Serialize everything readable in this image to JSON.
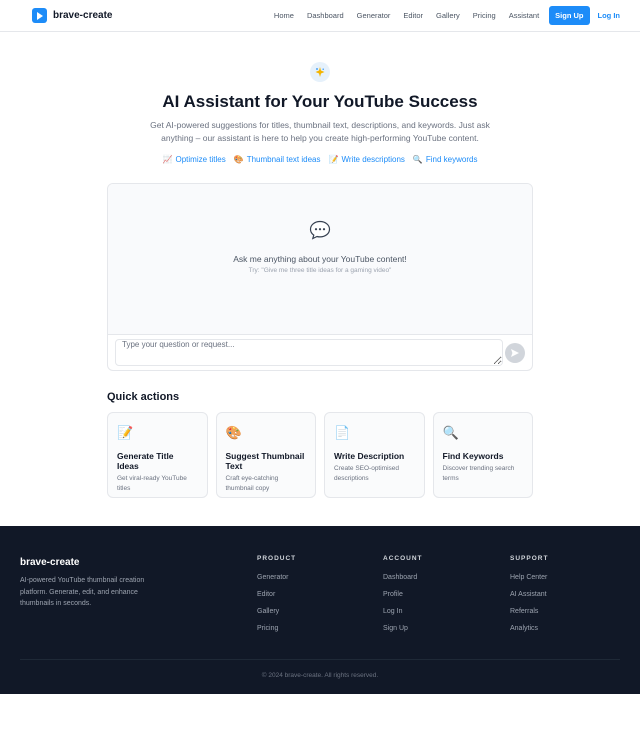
{
  "header": {
    "brand": "brave-create",
    "nav": [
      "Home",
      "Dashboard",
      "Generator",
      "Editor",
      "Gallery",
      "Pricing",
      "Assistant"
    ],
    "signup_label": "Sign Up",
    "login_label": "Log In"
  },
  "hero": {
    "title": "AI Assistant for Your YouTube Success",
    "subtitle": "Get AI-powered suggestions for titles, thumbnail text, descriptions, and keywords. Just ask anything – our assistant is here to help you create high-performing YouTube content.",
    "chips": [
      {
        "emoji": "📈",
        "label": "Optimize titles"
      },
      {
        "emoji": "🎨",
        "label": "Thumbnail text ideas"
      },
      {
        "emoji": "📝",
        "label": "Write descriptions"
      },
      {
        "emoji": "🔍",
        "label": "Find keywords"
      }
    ]
  },
  "chat": {
    "bubble_emoji": "💬",
    "prompt": "Ask me anything about your YouTube content!",
    "hint": "Try: \"Give me three title ideas for a gaming video\"",
    "input_value": "",
    "input_placeholder": "Type your question or request..."
  },
  "quick_actions": {
    "title": "Quick actions",
    "cards": [
      {
        "emoji": "📝",
        "name": "Generate Title Ideas",
        "desc": "Get viral-ready YouTube titles"
      },
      {
        "emoji": "🎨",
        "name": "Suggest Thumbnail Text",
        "desc": "Craft eye-catching thumbnail copy"
      },
      {
        "emoji": "📄",
        "name": "Write Description",
        "desc": "Create SEO-optimised descriptions"
      },
      {
        "emoji": "🔍",
        "name": "Find Keywords",
        "desc": "Discover trending search terms"
      }
    ]
  },
  "footer": {
    "brand": "brave-create",
    "description": "AI-powered YouTube thumbnail creation platform. Generate, edit, and enhance thumbnails in seconds.",
    "columns": [
      {
        "title": "PRODUCT",
        "links": [
          "Generator",
          "Editor",
          "Gallery",
          "Pricing"
        ]
      },
      {
        "title": "ACCOUNT",
        "links": [
          "Dashboard",
          "Profile",
          "Log In",
          "Sign Up"
        ]
      },
      {
        "title": "SUPPORT",
        "links": [
          "Help Center",
          "AI Assistant",
          "Referrals",
          "Analytics"
        ]
      }
    ],
    "copyright": "© 2024 brave-create. All rights reserved."
  },
  "colors": {
    "accent": "#1d8cf8",
    "footer_bg": "#111827"
  }
}
